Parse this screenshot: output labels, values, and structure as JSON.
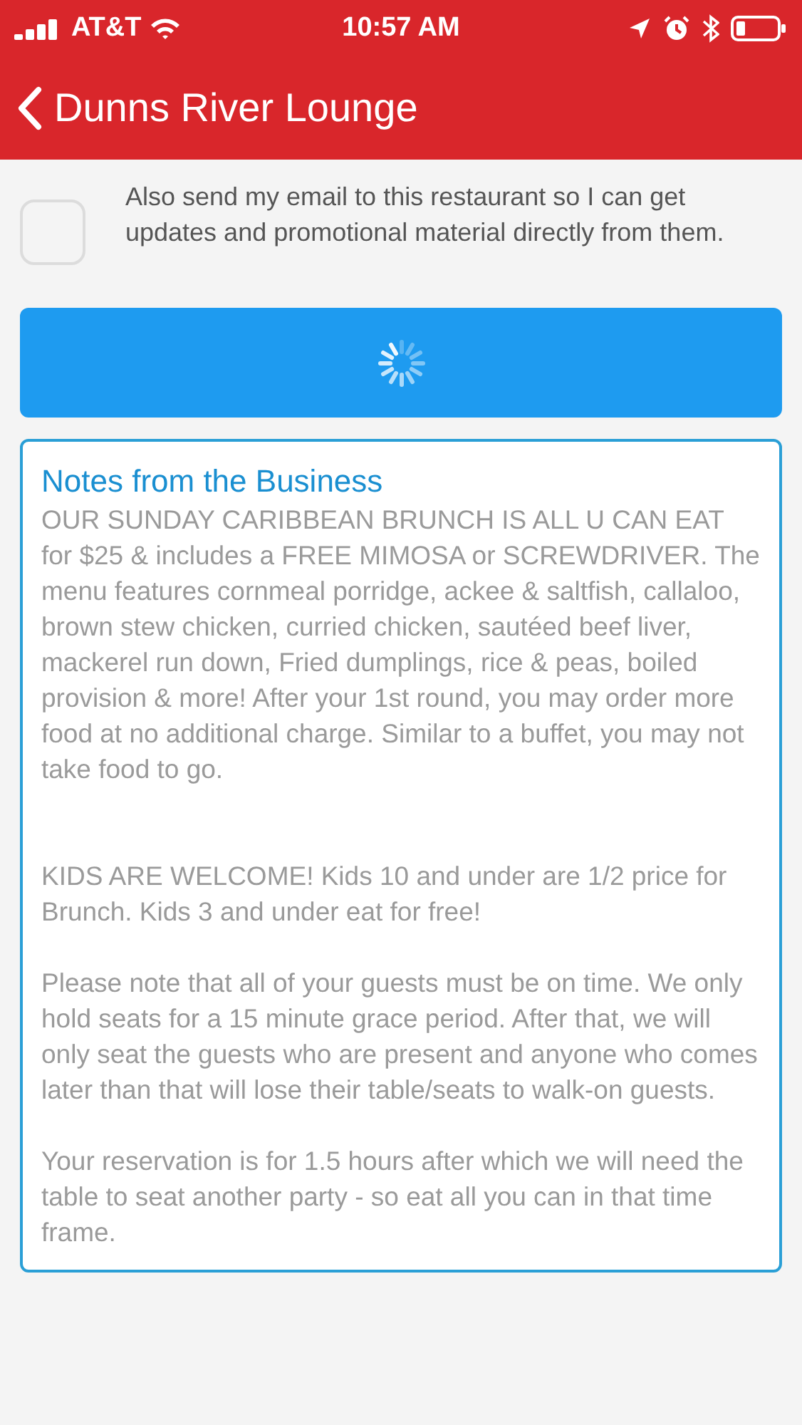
{
  "status_bar": {
    "carrier": "AT&T",
    "time": "10:57 AM"
  },
  "nav": {
    "title": "Dunns River Lounge"
  },
  "consent": {
    "checked": false,
    "label": "Also send my email to this restaurant so I can get updates and promotional material directly from them."
  },
  "submit": {
    "loading": true
  },
  "notes": {
    "title": "Notes from the Business",
    "paragraphs": [
      "OUR SUNDAY CARIBBEAN BRUNCH IS ALL U CAN EAT for $25 & includes a FREE MIMOSA or SCREWDRIVER.  The menu features cornmeal porridge, ackee & saltfish, callaloo, brown stew chicken, curried chicken, sautéed beef liver, mackerel run down, Fried dumplings, rice & peas, boiled provision & more!  After your 1st round, you may order more food at no additional charge.  Similar to a buffet, you may not take food to go.",
      "KIDS ARE WELCOME! Kids 10 and under are 1/2 price for Brunch. Kids 3 and under eat for free!",
      "Please note that all of your guests must be on time. We only hold seats for a 15 minute grace period. After that, we will only seat the guests who are present and anyone who comes later than that will lose their table/seats to walk-on guests.",
      "Your reservation is for 1.5 hours after which we will need the table to seat another party - so eat all you can in that time frame."
    ]
  }
}
